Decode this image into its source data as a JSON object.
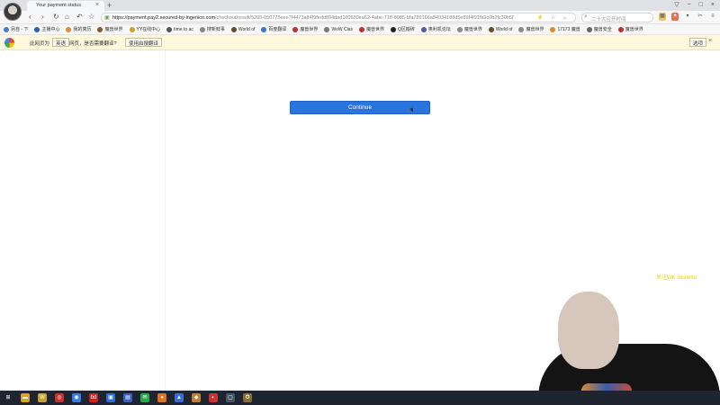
{
  "browser": {
    "tab_title": "Your payment status",
    "tab_close": "×",
    "new_tab": "+",
    "window_controls": [
      "▽",
      "−",
      "□",
      "×"
    ],
    "nav": {
      "back": "‹",
      "forward": "›",
      "reload": "↻",
      "home": "⌂",
      "undo": "↶",
      "star": "☆"
    },
    "url_host": "https://payment.pay2.secured-by-ingenico.com",
    "url_path": "/checkout/result/5205-050775eee7f4473a84f9fedd894dad160630ea62-4abe-71ff-8085-bfa789166a84034188d5e89f4f91fa9c0b2fc30b5f",
    "search_placeholder": "二十大召开时间",
    "url_icons": "⚡ ☆ ⌄",
    "extensions": [
      "▦",
      "✦",
      "▾",
      "✂",
      "≡"
    ]
  },
  "bookmarks": [
    {
      "label": "另自 - 下",
      "color": "#4a7bd0"
    },
    {
      "label": "主播中心",
      "color": "#2d5fb5"
    },
    {
      "label": "我的简历",
      "color": "#e08a2c"
    },
    {
      "label": "魔兽世界",
      "color": "#8a5a2c"
    },
    {
      "label": "YY在线中心",
      "color": "#d9a020"
    },
    {
      "label": "time to ac",
      "color": "#555555"
    },
    {
      "label": "搜新鲜事",
      "color": "#888888"
    },
    {
      "label": "World of",
      "color": "#6b4a2a"
    },
    {
      "label": "百度翻译",
      "color": "#3a70d8"
    },
    {
      "label": "魔兽世界",
      "color": "#c03030"
    },
    {
      "label": "WoW Clas",
      "color": "#777777"
    },
    {
      "label": "魔兽世界",
      "color": "#c03030"
    },
    {
      "label": "Q区搬砖",
      "color": "#222222"
    },
    {
      "label": "奥利机论坛",
      "color": "#5555aa"
    },
    {
      "label": "魔兽世界",
      "color": "#888888"
    },
    {
      "label": "World of",
      "color": "#6b4a2a"
    },
    {
      "label": "魔兽世界",
      "color": "#888888"
    },
    {
      "label": "17173 魔兽",
      "color": "#e08a2c"
    },
    {
      "label": "魔兽安全",
      "color": "#666666"
    },
    {
      "label": "魔兽世界",
      "color": "#c03030"
    }
  ],
  "translate_bar": {
    "prefix": "此网页为",
    "language": "英语",
    "question": "网页，是否需要翻译?",
    "translate_button": "使用启搜翻译",
    "options_button": "选项",
    "close": "×"
  },
  "page": {
    "continue_label": "Continue"
  },
  "stream_overlay": {
    "text": "关注WK Skeletor"
  },
  "taskbar": {
    "apps": [
      {
        "name": "start",
        "symbol": "⊞",
        "color": "#1e2430"
      },
      {
        "name": "explorer",
        "symbol": "▬",
        "color": "#d9a520"
      },
      {
        "name": "app-w",
        "symbol": "W",
        "color": "#c8a030"
      },
      {
        "name": "app-red",
        "symbol": "◎",
        "color": "#c83030"
      },
      {
        "name": "chrome",
        "symbol": "◉",
        "color": "#3a7be0"
      },
      {
        "name": "app-bd",
        "symbol": "bd",
        "color": "#d02020"
      },
      {
        "name": "app-blue",
        "symbol": "▣",
        "color": "#2d6fd0"
      },
      {
        "name": "app-doc",
        "symbol": "▤",
        "color": "#3a5fc0"
      },
      {
        "name": "wechat",
        "symbol": "✉",
        "color": "#2aa84a"
      },
      {
        "name": "app-orange",
        "symbol": "●",
        "color": "#e07020"
      },
      {
        "name": "app-bird",
        "symbol": "▲",
        "color": "#3a6fd0"
      },
      {
        "name": "app-game",
        "symbol": "◆",
        "color": "#c08030"
      },
      {
        "name": "app-media",
        "symbol": "◐",
        "color": "#d03030"
      },
      {
        "name": "app-tv",
        "symbol": "▢",
        "color": "#445566"
      },
      {
        "name": "app-wow",
        "symbol": "✪",
        "color": "#8a6a30"
      }
    ]
  }
}
